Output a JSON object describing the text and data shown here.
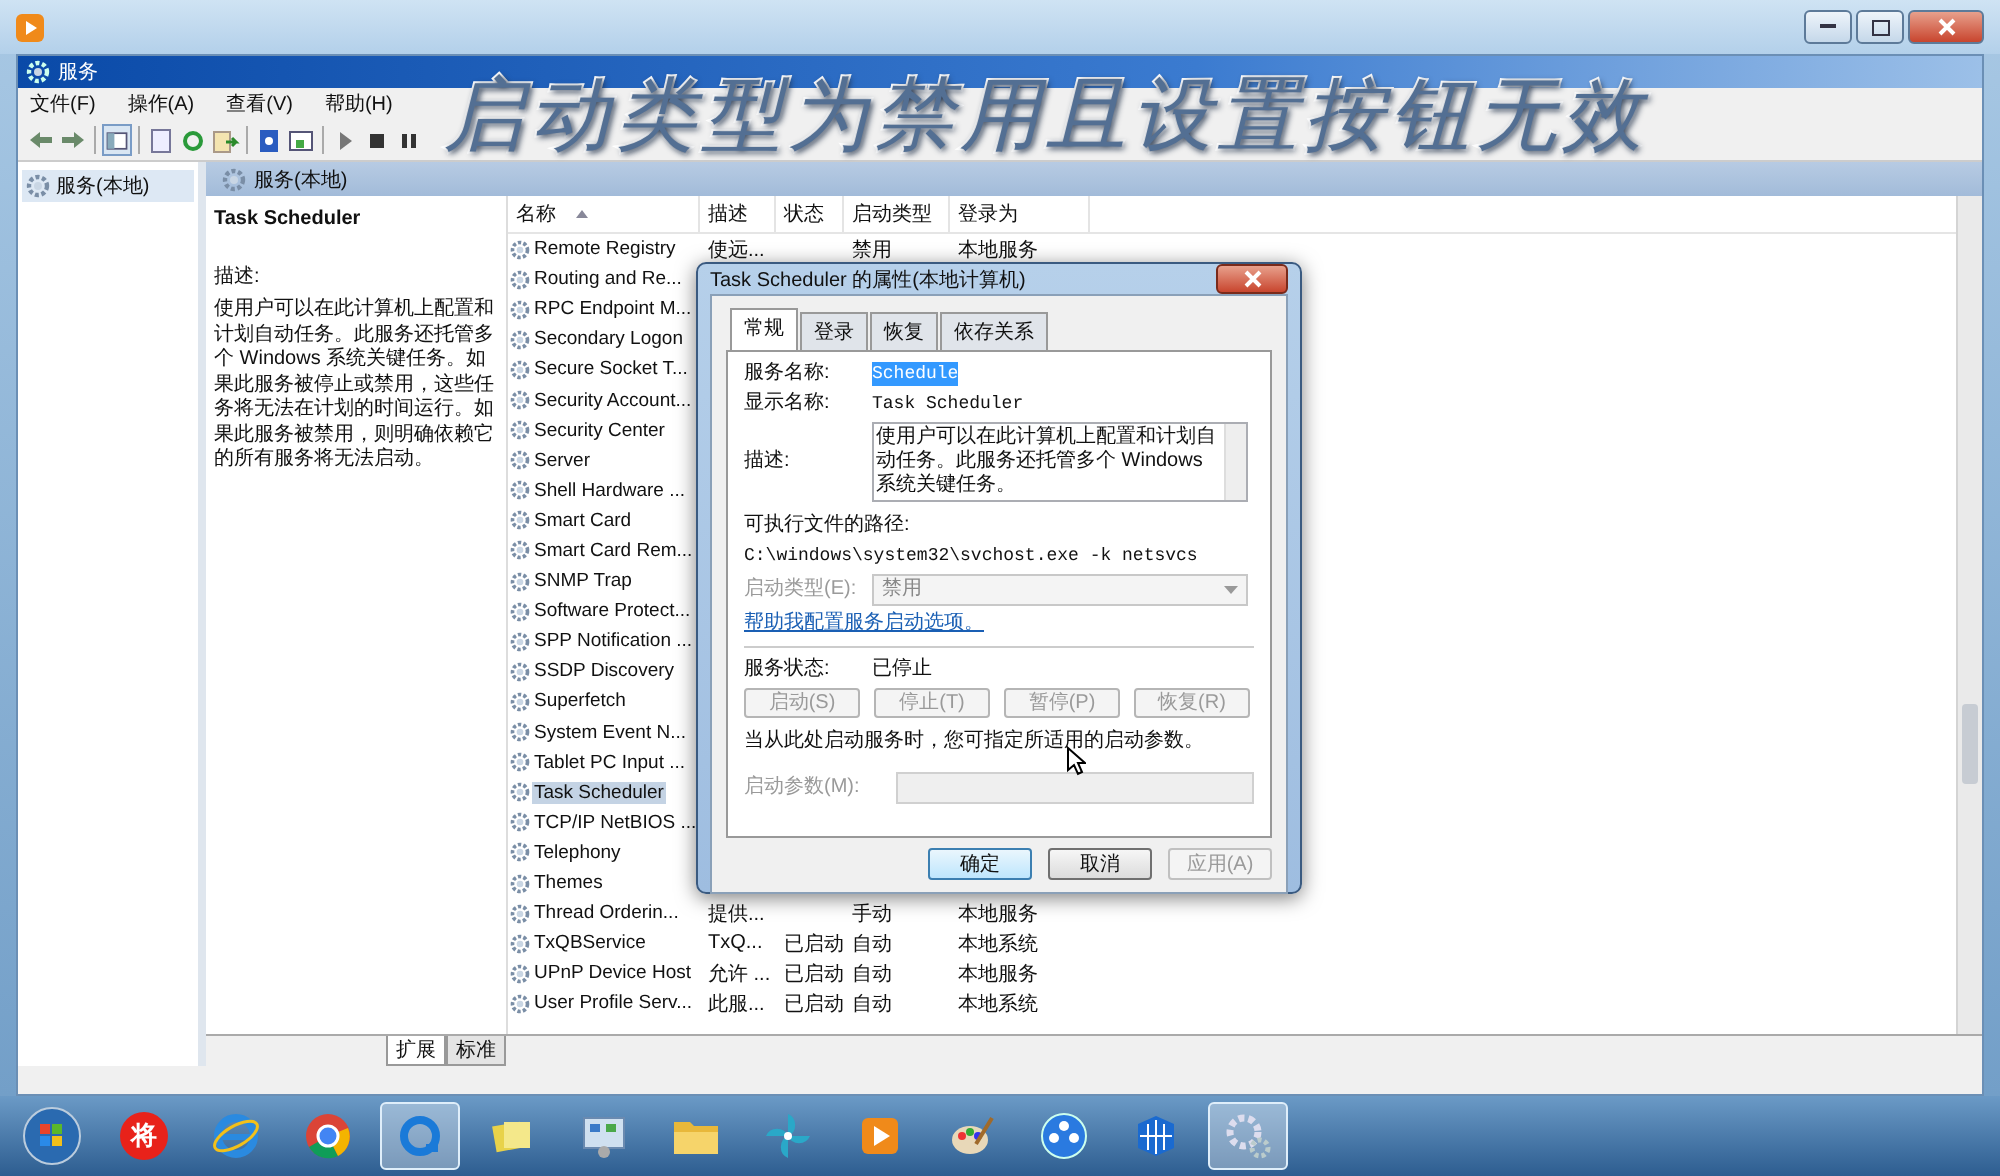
{
  "caption": "启动类型为禁用且设置按钮无效",
  "window": {
    "title": "服务"
  },
  "menu": [
    "文件(F)",
    "操作(A)",
    "查看(V)",
    "帮助(H)"
  ],
  "nav": [
    {
      "label": "服务(本地)",
      "selected": true
    }
  ],
  "pane_header": "服务(本地)",
  "detail": {
    "title": "Task Scheduler",
    "label": "描述:",
    "text": "使用户可以在此计算机上配置和计划自动任务。此服务还托管多个 Windows 系统关键任务。如果此服务被停止或禁用，这些任务将无法在计划的时间运行。如果此服务被禁用，则明确依赖它的所有服务将无法启动。"
  },
  "table": {
    "columns": [
      "名称",
      "描述",
      "状态",
      "启动类型",
      "登录为"
    ],
    "rows": [
      {
        "name": "Remote Registry",
        "description": "使远...",
        "startup": "禁用",
        "logon": "本地服务",
        "selected": false
      },
      {
        "name": "Routing and Re...",
        "selected": false
      },
      {
        "name": "RPC Endpoint M...",
        "selected": false
      },
      {
        "name": "Secondary Logon",
        "selected": false
      },
      {
        "name": "Secure Socket T...",
        "selected": false
      },
      {
        "name": "Security Account...",
        "selected": false
      },
      {
        "name": "Security Center",
        "selected": false
      },
      {
        "name": "Server",
        "selected": false
      },
      {
        "name": "Shell Hardware ...",
        "selected": false
      },
      {
        "name": "Smart Card",
        "selected": false
      },
      {
        "name": "Smart Card Rem...",
        "selected": false
      },
      {
        "name": "SNMP Trap",
        "selected": false
      },
      {
        "name": "Software Protect...",
        "selected": false
      },
      {
        "name": "SPP Notification ...",
        "selected": false
      },
      {
        "name": "SSDP Discovery",
        "selected": false
      },
      {
        "name": "Superfetch",
        "selected": false
      },
      {
        "name": "System Event N...",
        "selected": false
      },
      {
        "name": "Tablet PC Input ...",
        "selected": false
      },
      {
        "name": "Task Scheduler",
        "selected": true
      },
      {
        "name": "TCP/IP NetBIOS ...",
        "selected": false
      },
      {
        "name": "Telephony",
        "selected": false
      },
      {
        "name": "Themes",
        "selected": false
      },
      {
        "name": "Thread Orderin...",
        "description": "提供...",
        "startup": "手动",
        "logon": "本地服务",
        "selected": false
      },
      {
        "name": "TxQBService",
        "description": "TxQ...",
        "status": "已启动",
        "startup": "自动",
        "logon": "本地系统",
        "selected": false
      },
      {
        "name": "UPnP Device Host",
        "description": "允许 ...",
        "status": "已启动",
        "startup": "自动",
        "logon": "本地服务",
        "selected": false
      },
      {
        "name": "User Profile Serv...",
        "description": "此服...",
        "status": "已启动",
        "startup": "自动",
        "logon": "本地系统",
        "selected": false
      }
    ]
  },
  "bottom_tabs": [
    {
      "label": "扩展",
      "selected": true
    },
    {
      "label": "标准",
      "selected": false
    }
  ],
  "dialog": {
    "title": "Task Scheduler 的属性(本地计算机)",
    "tabs": [
      {
        "label": "常规",
        "selected": true
      },
      {
        "label": "登录",
        "selected": false
      },
      {
        "label": "恢复",
        "selected": false
      },
      {
        "label": "依存关系",
        "selected": false
      }
    ],
    "service_name": {
      "label": "服务名称:",
      "value": "Schedule"
    },
    "display_name": {
      "label": "显示名称:",
      "value": "Task Scheduler"
    },
    "description": {
      "label": "描述:",
      "value": "使用户可以在此计算机上配置和计划自动任务。此服务还托管多个 Windows 系统关键任务。"
    },
    "path_label": "可执行文件的路径:",
    "path": "C:\\windows\\system32\\svchost.exe -k netsvcs",
    "startup_type": {
      "label": "启动类型(E):",
      "value": "禁用",
      "disabled": true
    },
    "help_link": "帮助我配置服务启动选项。",
    "status": {
      "label": "服务状态:",
      "value": "已停止"
    },
    "service_buttons": [
      {
        "label": "启动(S)",
        "disabled": true
      },
      {
        "label": "停止(T)",
        "disabled": true
      },
      {
        "label": "暂停(P)",
        "disabled": true
      },
      {
        "label": "恢复(R)",
        "disabled": true
      }
    ],
    "params_hint": "当从此处启动服务时，您可指定所适用的启动参数。",
    "params": {
      "label": "启动参数(M):",
      "disabled": true
    },
    "buttons": [
      {
        "label": "确定",
        "disabled": false
      },
      {
        "label": "取消",
        "disabled": false
      },
      {
        "label": "应用(A)",
        "disabled": true
      }
    ]
  },
  "taskbar": [
    {
      "kind": "start",
      "active": false
    },
    {
      "kind": "badge",
      "glyph": "将",
      "active": false
    },
    {
      "kind": "ie",
      "active": false
    },
    {
      "kind": "chrome",
      "active": false
    },
    {
      "kind": "ring",
      "active": true
    },
    {
      "kind": "notes",
      "active": false
    },
    {
      "kind": "panel",
      "active": false
    },
    {
      "kind": "folder",
      "active": false
    },
    {
      "kind": "pinwheel",
      "active": false
    },
    {
      "kind": "player",
      "active": false
    },
    {
      "kind": "paint",
      "active": false
    },
    {
      "kind": "film",
      "active": false
    },
    {
      "kind": "grid",
      "active": false
    },
    {
      "kind": "gear",
      "active": true
    }
  ]
}
